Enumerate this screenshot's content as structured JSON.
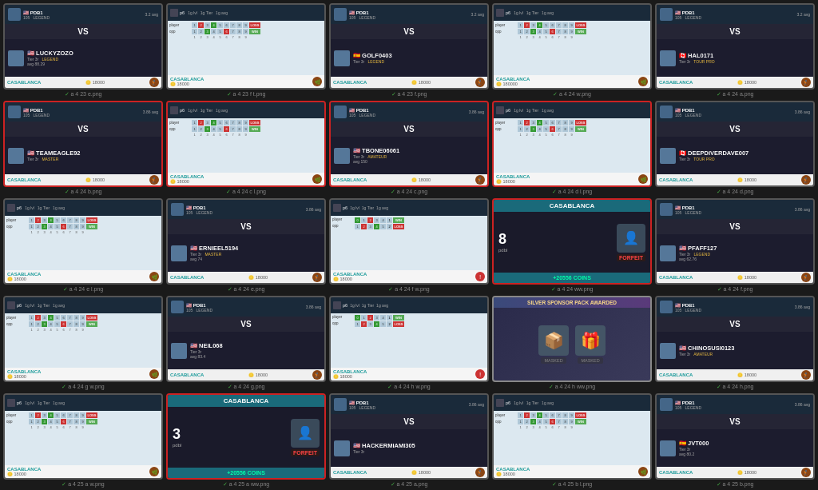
{
  "cards": [
    {
      "id": "a_4_23_e",
      "type": "vs",
      "border": "normal",
      "player1": {
        "flag": "🇺🇸",
        "name": "PDB1",
        "level": "105",
        "tier": "LEGEND",
        "avg": "3.2"
      },
      "player2": {
        "flag": "🇺🇸",
        "name": "LUCKYZOZO",
        "tier": "Tier 3r",
        "tierName": "LEGEND",
        "avg": "88.29"
      },
      "filename": "a 4 23 e.png"
    },
    {
      "id": "a_4_23_ft",
      "type": "scoreboard",
      "border": "normal",
      "casa": "CASABLANCA",
      "coins": "18000",
      "filename": "a 4 23 f t.png"
    },
    {
      "id": "a_4_23_f",
      "type": "vs",
      "border": "normal",
      "player1": {
        "flag": "🇺🇸",
        "name": "PDB1",
        "level": "105",
        "tier": "LEGEND",
        "avg": "3.2"
      },
      "player2": {
        "flag": "🇪🇸",
        "name": "GOLF0403",
        "tier": "Tier 3r",
        "tierName": "LEGEND",
        "avg": ""
      },
      "filename": "a 4 23 f.png"
    },
    {
      "id": "a_4_24_w",
      "type": "scoreboard",
      "border": "normal",
      "casa": "CASABLANCA",
      "coins": "180000",
      "filename": "a 4 24 w.png"
    },
    {
      "id": "a_4_24_a",
      "type": "vs",
      "border": "normal",
      "player1": {
        "flag": "🇺🇸",
        "name": "PDB1",
        "level": "105",
        "tier": "LEGEND",
        "avg": "3.2"
      },
      "player2": {
        "flag": "🇨🇦",
        "name": "HAL0171",
        "tier": "Tier 3r",
        "tierName": "TOUR PRO",
        "avg": ""
      },
      "filename": "a 4 24 a.png"
    },
    {
      "id": "a_4_24_b",
      "type": "vs",
      "border": "red",
      "player1": {
        "flag": "🇺🇸",
        "name": "PDB1",
        "level": "105",
        "tier": "LEGEND",
        "avg": "3.86"
      },
      "player2": {
        "flag": "🇺🇸",
        "name": "TEAMEAGLE92",
        "tier": "Tier 3r",
        "tierName": "MASTER",
        "avg": ""
      },
      "filename": "a 4 24 b.png"
    },
    {
      "id": "a_4_24_cl",
      "type": "scoreboard",
      "border": "red",
      "casa": "CASABLANCA",
      "coins": "18000",
      "filename": "a 4 24 c l.png"
    },
    {
      "id": "a_4_24_c",
      "type": "vs",
      "border": "red",
      "player1": {
        "flag": "🇺🇸",
        "name": "PDB1",
        "level": "105",
        "tier": "LEGEND",
        "avg": "3.86"
      },
      "player2": {
        "flag": "🇺🇸",
        "name": "TBONE06061",
        "tier": "Tier 3r",
        "tierName": "AMATEUR",
        "avg": "150"
      },
      "filename": "a 4 24 c.png"
    },
    {
      "id": "a_4_24_dl",
      "type": "scoreboard",
      "border": "red",
      "casa": "CASABLANCA",
      "coins": "18000",
      "filename": "a 4 24 d l.png"
    },
    {
      "id": "a_4_24_d",
      "type": "vs",
      "border": "normal",
      "player1": {
        "flag": "🇺🇸",
        "name": "PDB1",
        "level": "105",
        "tier": "LEGEND",
        "avg": "3.86"
      },
      "player2": {
        "flag": "🇨🇦",
        "name": "DEEPDIVERDAVE007",
        "tier": "Tier 3r",
        "tierName": "TOUR PRO",
        "avg": ""
      },
      "filename": "a 4 24 d.png"
    },
    {
      "id": "a_4_24_el",
      "type": "scoreboard",
      "border": "normal",
      "casa": "CASABLANCA",
      "coins": "18000",
      "filename": "a 4 24 e l.png"
    },
    {
      "id": "a_4_24_e",
      "type": "vs",
      "border": "normal",
      "player1": {
        "flag": "🇺🇸",
        "name": "PDB1",
        "level": "105",
        "tier": "LEGEND",
        "avg": "3.86"
      },
      "player2": {
        "flag": "🇺🇸",
        "name": "ERNIEEL5194",
        "tier": "Tier 3r",
        "tierName": "MASTER",
        "avg": "74"
      },
      "filename": "a 4 24 e.png"
    },
    {
      "id": "a_4_24_fw",
      "type": "scoreboard_alt",
      "border": "normal",
      "casa": "CASABLANCA",
      "coins": "18000",
      "filename": "a 4 24 f w.png"
    },
    {
      "id": "a_4_24_forfeit",
      "type": "forfeit",
      "border": "red",
      "title": "CASABLANCA",
      "num": "8",
      "player": "pdbl",
      "coins": "+20556 COINS",
      "filename": "a 4 24 ww.png"
    },
    {
      "id": "a_4_24_f",
      "type": "vs",
      "border": "normal",
      "player1": {
        "flag": "🇺🇸",
        "name": "PDB1",
        "level": "105",
        "tier": "LEGEND",
        "avg": "3.86"
      },
      "player2": {
        "flag": "🇺🇸",
        "name": "PFAFF127",
        "tier": "Tier 3r",
        "tierName": "LEGEND",
        "avg": "62.76"
      },
      "filename": "a 4 24 f.png"
    },
    {
      "id": "a_4_24_gw",
      "type": "scoreboard",
      "border": "normal",
      "casa": "CASABLANCA",
      "coins": "18000",
      "filename": "a 4 24 g w.png"
    },
    {
      "id": "a_4_24_g",
      "type": "vs",
      "border": "normal",
      "player1": {
        "flag": "🇺🇸",
        "name": "PDB1",
        "level": "105",
        "tier": "LEGEND",
        "avg": "3.86"
      },
      "player2": {
        "flag": "🇺🇸",
        "name": "NEIL068",
        "tier": "Tier 3r",
        "tierName": "",
        "avg": "83.4"
      },
      "filename": "a 4 24 g.png"
    },
    {
      "id": "a_4_24_hw",
      "type": "scoreboard_alt",
      "border": "normal",
      "casa": "CASABLANCA",
      "coins": "18000",
      "filename": "a 4 24 h w.png"
    },
    {
      "id": "a_4_24_hww",
      "type": "silver",
      "border": "normal",
      "title": "SILVER SPONSOR PACK AWARDED",
      "filename": "a 4 24 h ww.png"
    },
    {
      "id": "a_4_24_h",
      "type": "vs",
      "border": "normal",
      "player1": {
        "flag": "🇺🇸",
        "name": "PDB1",
        "level": "105",
        "tier": "LEGEND",
        "avg": "3.86"
      },
      "player2": {
        "flag": "🇺🇸",
        "name": "CHINOSUSI0123",
        "tier": "Tier 3r",
        "tierName": "AMATEUR",
        "avg": ""
      },
      "filename": "a 4 24 h.png"
    },
    {
      "id": "a_4_25_aw",
      "type": "scoreboard",
      "border": "normal",
      "casa": "CASABLANCA",
      "coins": "18000",
      "filename": "a 4 25 a w.png"
    },
    {
      "id": "a_4_25_ww",
      "type": "forfeit",
      "border": "red",
      "title": "CASABLANCA",
      "num": "3",
      "player": "pdbl",
      "coins": "+20556 COINS",
      "filename": "a 4 25 a ww.png"
    },
    {
      "id": "a_4_25_a",
      "type": "vs",
      "border": "normal",
      "player1": {
        "flag": "🇺🇸",
        "name": "PDB1",
        "level": "105",
        "tier": "LEGEND",
        "avg": "3.86"
      },
      "player2": {
        "flag": "🇺🇸",
        "name": "HACKERMIAMI305",
        "tier": "Tier 3r",
        "tierName": "",
        "avg": ""
      },
      "filename": "a 4 25 a.png"
    },
    {
      "id": "a_4_25_bl",
      "type": "scoreboard",
      "border": "normal",
      "casa": "CASABLANCA",
      "coins": "18000",
      "filename": "a 4 25 b l.png"
    },
    {
      "id": "a_4_25_b",
      "type": "vs",
      "border": "normal",
      "player1": {
        "flag": "🇺🇸",
        "name": "PDB1",
        "level": "105",
        "tier": "LEGEND",
        "avg": "3.86"
      },
      "player2": {
        "flag": "🇪🇸",
        "name": "JVT000",
        "tier": "Tier 3r",
        "tierName": "",
        "avg": "80.2"
      },
      "filename": "a 4 25 b.png"
    }
  ]
}
